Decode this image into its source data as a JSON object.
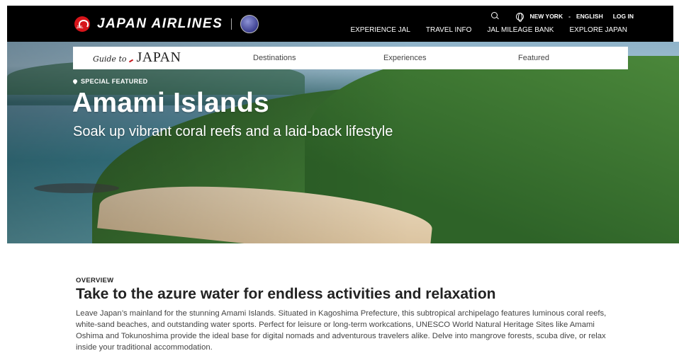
{
  "header": {
    "logo_mark_text": "JAL",
    "brand": "JAPAN AIRLINES",
    "utility": {
      "location": "NEW YORK",
      "separator": "-",
      "language": "ENGLISH",
      "login": "LOG IN"
    },
    "nav": [
      "EXPERIENCE JAL",
      "TRAVEL INFO",
      "JAL MILEAGE BANK",
      "EXPLORE JAPAN"
    ]
  },
  "subnav": {
    "logo_script": "Guide to",
    "logo_main": "JAPAN",
    "items": [
      "Destinations",
      "Experiences",
      "Featured"
    ]
  },
  "hero": {
    "badge": "SPECIAL FEATURED",
    "title": "Amami Islands",
    "subtitle": "Soak up vibrant coral reefs and a laid-back lifestyle"
  },
  "overview": {
    "label": "OVERVIEW",
    "title": "Take to the azure water for endless activities and relaxation",
    "body": "Leave Japan’s mainland for the stunning Amami Islands. Situated in Kagoshima Prefecture, this subtropical archipelago features luminous coral reefs, white-sand beaches, and outstanding water sports. Perfect for leisure or long-term workcations, UNESCO World Natural Heritage Sites like Amami Oshima and Tokunoshima provide the ideal base for digital nomads and adventurous travelers alike. Delve into mangrove forests, scuba dive, or relax inside your traditional accommodation."
  },
  "colors": {
    "topbar": "#000000",
    "brand_red": "#d7141a",
    "text_dark": "#222222"
  },
  "icons": [
    "jal-crane-icon",
    "oneworld-icon",
    "search-icon",
    "globe-icon",
    "location-pin-icon"
  ]
}
